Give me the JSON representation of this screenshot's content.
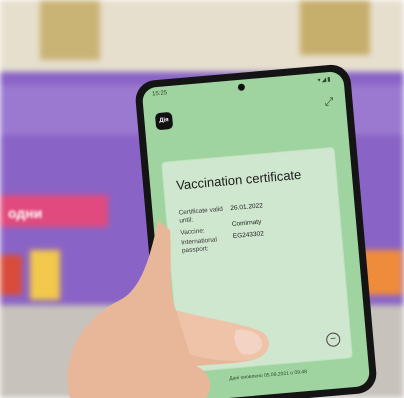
{
  "phone": {
    "status_time": "15:25",
    "status_icons": "▾◢▮",
    "app_logo": "Дія",
    "close_icon": "⤢"
  },
  "certificate": {
    "title": "Vaccination certificate",
    "rows": [
      {
        "label": "Certificate valid until:",
        "value": "26.01.2022"
      },
      {
        "label": "Vaccine:",
        "value": "Comirnaty"
      },
      {
        "label": "International passport:",
        "value": "EG243302"
      }
    ],
    "footer": "Дані оновлено 05.09.2021 о 09:48"
  },
  "background": {
    "sign_text": "одни"
  },
  "colors": {
    "screen": "#9fd39f",
    "card": "#cfe6cf",
    "wall": "#8a63c6"
  }
}
